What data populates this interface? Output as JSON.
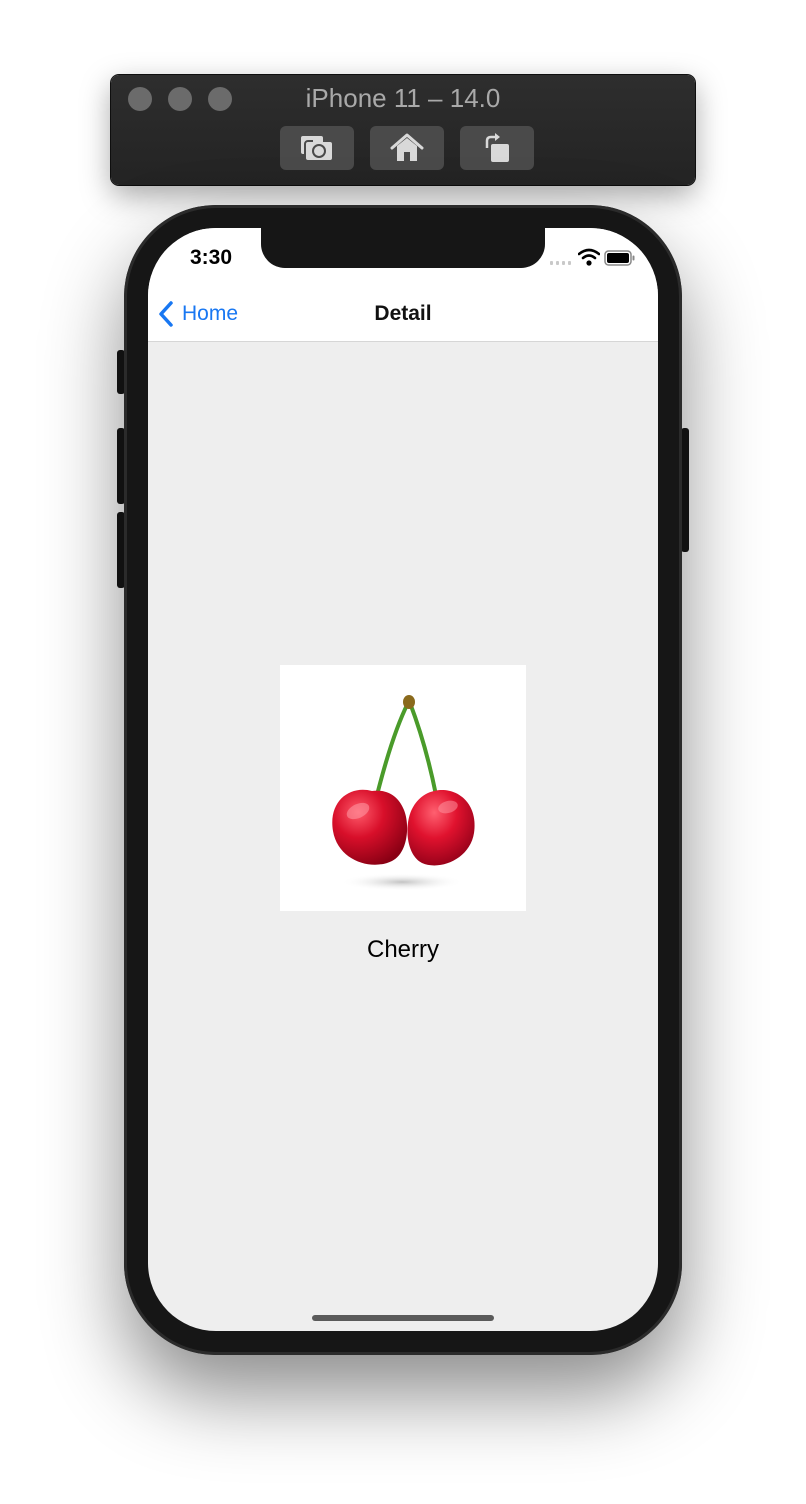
{
  "simulator": {
    "title": "iPhone 11 – 14.0",
    "buttons": [
      {
        "icon": "screenshot-camera-icon"
      },
      {
        "icon": "home-icon"
      },
      {
        "icon": "rotate-icon"
      }
    ],
    "traffic_light_color": "#6b6b6b"
  },
  "status_bar": {
    "time": "3:30",
    "icons": [
      "cellular-signal-icon",
      "wifi-icon",
      "battery-icon"
    ]
  },
  "nav_bar": {
    "back_label": "Home",
    "title": "Detail",
    "accent_color": "#1877f2"
  },
  "content": {
    "image_icon": "cherry-image",
    "caption": "Cherry",
    "background_color": "#eeeeee"
  }
}
